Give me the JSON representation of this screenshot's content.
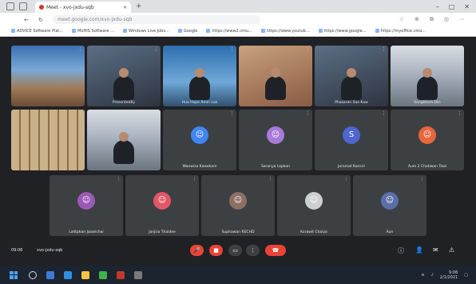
{
  "browser": {
    "tab_title": "Meet - xvo-jxdu-sqb",
    "address": "meet.google.com/xvo-jxdu-sqb",
    "bookmarks": [
      "ADVICE Software Plat...",
      "MoHIS Software ...",
      "Windows Live Jobs...",
      "Google",
      "https://www2.cmu...",
      "https://www.youtub...",
      "https://www.google...",
      "https://myoffice.cmu..."
    ]
  },
  "meet": {
    "tiles_row1": [
      {
        "name": "",
        "kind": "slide"
      },
      {
        "name": "PresentedBy",
        "kind": "cam"
      },
      {
        "name": "Hua Hope Amin Lak",
        "kind": "blue"
      },
      {
        "name": "",
        "kind": "warm"
      },
      {
        "name": "Phasaran Sae Kaw",
        "kind": "cam"
      },
      {
        "name": "Sangkhom Dtn",
        "kind": "room"
      }
    ],
    "tiles_row2": [
      {
        "name": "",
        "kind": "shelf"
      },
      {
        "name": "",
        "kind": "room"
      },
      {
        "name": "Wanwisa Kaewkam",
        "avatar": "☺",
        "color": "#4285f4"
      },
      {
        "name": "Saranya Lopkan",
        "avatar": "☺",
        "color": "#a87bd8"
      },
      {
        "name": "Jaramat Konsiri",
        "avatar": "S",
        "color": "#4f66cf"
      },
      {
        "name": "Aum 2 Chotiwan Tawi",
        "avatar": "☺",
        "color": "#e8663d"
      }
    ],
    "tiles_row3": [
      {
        "name": "Lalitphan Jaowichai",
        "avatar": "☺",
        "color": "#9b59b6"
      },
      {
        "name": "Janjira Thaidee",
        "avatar": "☺",
        "color": "#e05766"
      },
      {
        "name": "Suphawan RECHD",
        "avatar": "☺",
        "color": "#8d6e63"
      },
      {
        "name": "Korawit Chaiya",
        "avatar": "☺",
        "color": "#cfcfcf"
      },
      {
        "name": "Aun",
        "avatar": "☺",
        "color": "#5b6ea8"
      }
    ],
    "time": "09:06",
    "code": "xvo-jxdu-sqb"
  },
  "taskbar": {
    "clock_time": "9:06",
    "clock_date": "2/1/2021"
  }
}
